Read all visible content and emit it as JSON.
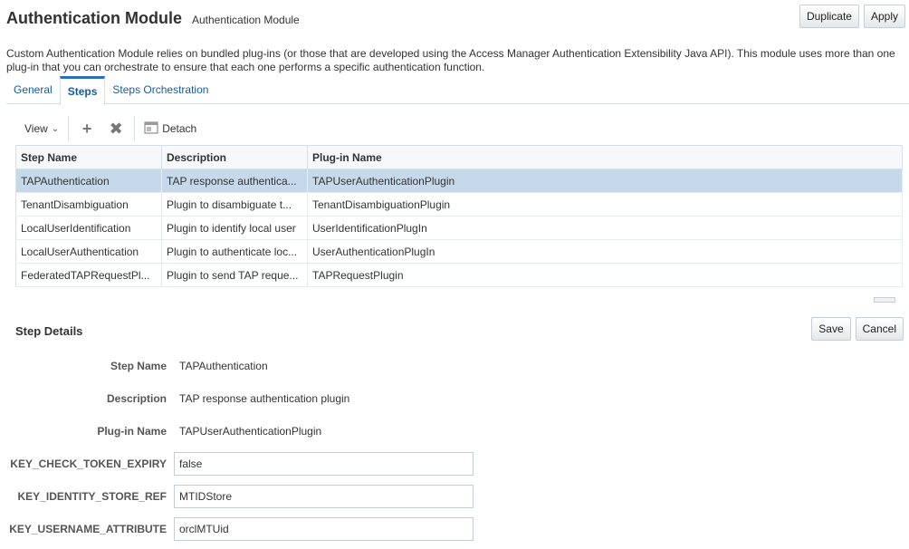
{
  "header": {
    "title": "Authentication Module",
    "subtitle": "Authentication Module"
  },
  "top_actions": {
    "duplicate": "Duplicate",
    "apply": "Apply"
  },
  "description": "Custom Authentication Module relies on bundled plug-ins (or those that are developed using the Access Manager Authentication Extensibility Java API). This module uses more than one plug-in that you can orchestrate to ensure that each one performs a specific authentication function.",
  "tabs": [
    {
      "label": "General"
    },
    {
      "label": "Steps"
    },
    {
      "label": "Steps Orchestration"
    }
  ],
  "toolbar": {
    "view": "View",
    "add_icon": "plus-icon",
    "delete_icon": "x-icon",
    "detach": "Detach"
  },
  "table": {
    "columns": [
      "Step Name",
      "Description",
      "Plug-in Name"
    ],
    "rows": [
      [
        "TAPAuthentication",
        "TAP response authentica...",
        "TAPUserAuthenticationPlugin"
      ],
      [
        "TenantDisambiguation",
        "Plugin to disambiguate t...",
        "TenantDisambiguationPlugin"
      ],
      [
        "LocalUserIdentification",
        "Plugin to identify local user",
        "UserIdentificationPlugIn"
      ],
      [
        "LocalUserAuthentication",
        "Plugin to authenticate loc...",
        "UserAuthenticationPlugIn"
      ],
      [
        "FederatedTAPRequestPl...",
        "Plugin to send TAP reque...",
        "TAPRequestPlugin"
      ]
    ]
  },
  "details": {
    "title": "Step Details",
    "save": "Save",
    "cancel": "Cancel",
    "step_name_label": "Step Name",
    "step_name": "TAPAuthentication",
    "description_label": "Description",
    "description": "TAP response authentication plugin",
    "plugin_label": "Plug-in Name",
    "plugin": "TAPUserAuthenticationPlugin",
    "params": [
      {
        "label": "KEY_CHECK_TOKEN_EXPIRY",
        "value": "false"
      },
      {
        "label": "KEY_IDENTITY_STORE_REF",
        "value": "MTIDStore"
      },
      {
        "label": "KEY_USERNAME_ATTRIBUTE",
        "value": "orclMTUid"
      }
    ]
  },
  "colors": {
    "selected_row": "#c6d9ea",
    "link": "#145c9e",
    "accent": "#2a6fb7"
  }
}
